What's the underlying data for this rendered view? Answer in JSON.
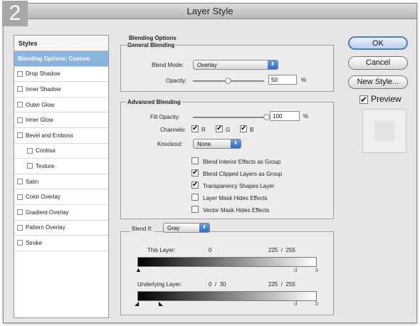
{
  "step_number": "2",
  "window": {
    "title": "Layer Style"
  },
  "styles_panel": {
    "header": "Styles",
    "items": [
      {
        "label": "Blending Options: Custom",
        "active": true,
        "checkbox": false,
        "sub": false
      },
      {
        "label": "Drop Shadow",
        "active": false,
        "checkbox": true,
        "sub": false
      },
      {
        "label": "Inner Shadow",
        "active": false,
        "checkbox": true,
        "sub": false
      },
      {
        "label": "Outer Glow",
        "active": false,
        "checkbox": true,
        "sub": false
      },
      {
        "label": "Inner Glow",
        "active": false,
        "checkbox": true,
        "sub": false
      },
      {
        "label": "Bevel and Emboss",
        "active": false,
        "checkbox": true,
        "sub": false
      },
      {
        "label": "Contour",
        "active": false,
        "checkbox": true,
        "sub": true
      },
      {
        "label": "Texture",
        "active": false,
        "checkbox": true,
        "sub": true
      },
      {
        "label": "Satin",
        "active": false,
        "checkbox": true,
        "sub": false
      },
      {
        "label": "Color Overlay",
        "active": false,
        "checkbox": true,
        "sub": false
      },
      {
        "label": "Gradient Overlay",
        "active": false,
        "checkbox": true,
        "sub": false
      },
      {
        "label": "Pattern Overlay",
        "active": false,
        "checkbox": true,
        "sub": false
      },
      {
        "label": "Stroke",
        "active": false,
        "checkbox": true,
        "sub": false
      }
    ]
  },
  "blending_options": {
    "title": "Blending Options",
    "general": {
      "title": "General Blending",
      "blend_mode_label": "Blend Mode:",
      "blend_mode_value": "Overlay",
      "opacity_label": "Opacity:",
      "opacity_value": "50",
      "opacity_fraction": 0.5,
      "percent": "%"
    },
    "advanced": {
      "title": "Advanced Blending",
      "fill_opacity_label": "Fill Opacity:",
      "fill_opacity_value": "100",
      "fill_opacity_fraction": 1.0,
      "percent": "%",
      "channels_label": "Channels:",
      "channel_r": "R",
      "channel_g": "G",
      "channel_b": "B",
      "knockout_label": "Knockout:",
      "knockout_value": "None",
      "options": [
        {
          "label": "Blend Interior Effects as Group",
          "checked": false
        },
        {
          "label": "Blend Clipped Layers as Group",
          "checked": true
        },
        {
          "label": "Transparency Shapes Layer",
          "checked": true
        },
        {
          "label": "Layer Mask Hides Effects",
          "checked": false
        },
        {
          "label": "Vector Mask Hides Effects",
          "checked": false
        }
      ]
    },
    "blend_if": {
      "label": "Blend If:",
      "value": "Gray",
      "this_layer_label": "This Layer:",
      "this_layer_low": "0",
      "this_layer_high": "225  /  255",
      "underlying_label": "Underlying Layer:",
      "underlying_low": "0  /  30",
      "underlying_high": "225  /  255"
    }
  },
  "buttons": {
    "ok": "OK",
    "cancel": "Cancel",
    "new_style": "New Style...",
    "preview": "Preview",
    "preview_checked": true
  },
  "colors": {
    "accent": "#8ab4e0",
    "popup_button": "#2c6bc8"
  }
}
